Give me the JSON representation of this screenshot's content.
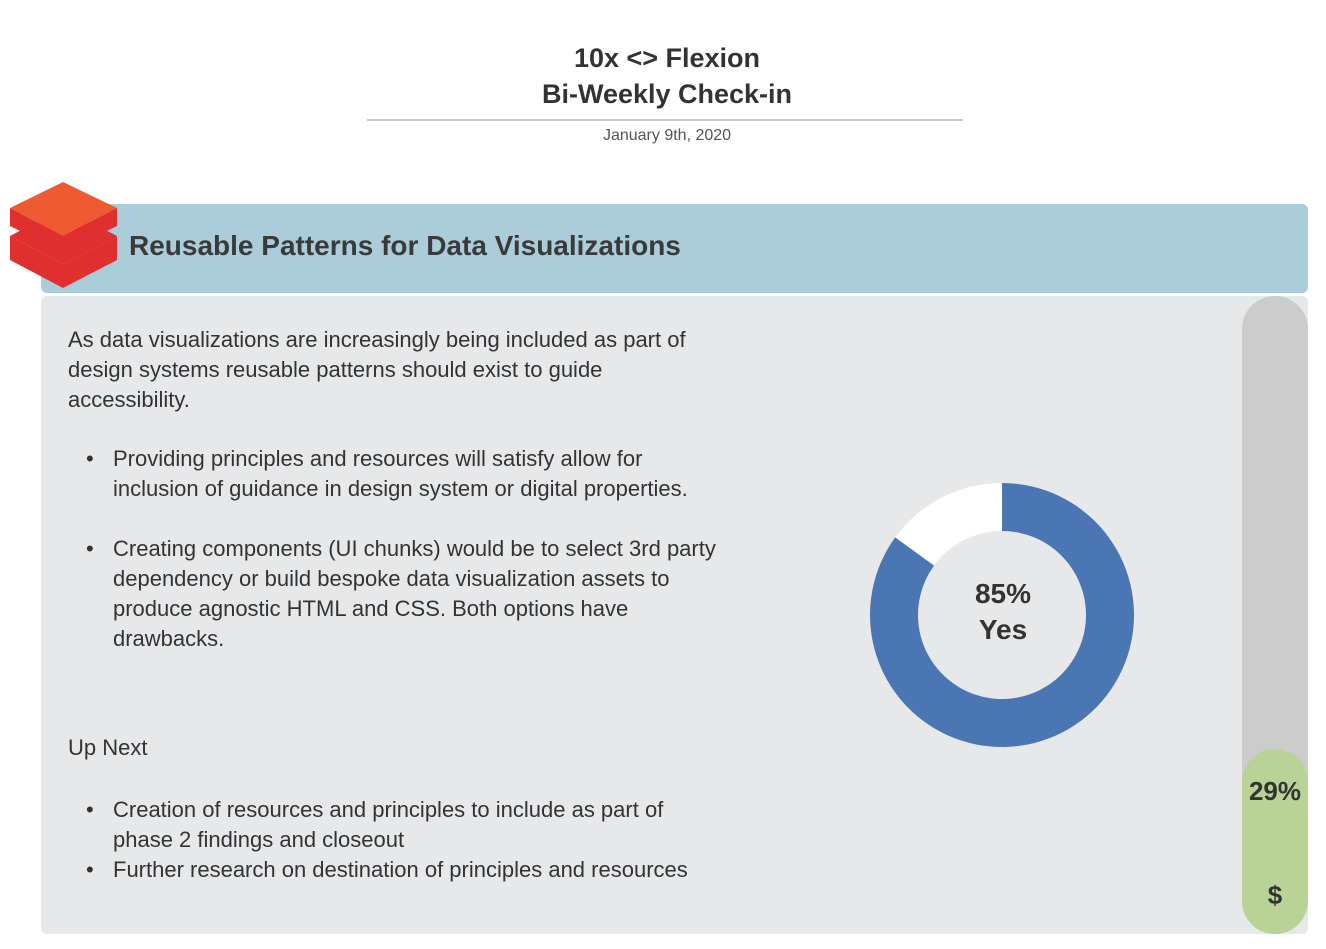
{
  "header": {
    "title_line1": "10x <> Flexion",
    "title_line2": "Bi-Weekly Check-in",
    "date": "January 9th, 2020"
  },
  "banner": {
    "title": "Reusable Patterns for Data Visualizations",
    "logo_icon": "stacked-layers-icon",
    "colors": {
      "banner_bg": "#abcdd9",
      "logo_top": "#f05a33",
      "logo_bottom": "#e02f2f"
    }
  },
  "content": {
    "intro": "As data visualizations are increasingly being included as part of design systems reusable patterns should exist to guide accessibility.",
    "bullets": [
      "Providing principles and resources will satisfy allow for inclusion of guidance in design system or digital properties.",
      "Creating components (UI chunks) would be to select 3rd party dependency or build bespoke data visualization assets to produce agnostic HTML and CSS. Both options have drawbacks."
    ],
    "up_next_heading": "Up Next",
    "up_next_items": [
      "Creation of resources and principles to include as part of phase 2 findings and closeout",
      "Further research on destination of principles and resources"
    ],
    "bullet_glyph": "•"
  },
  "donut": {
    "value_label": "85%",
    "category_label": "Yes",
    "fraction": 0.85,
    "colors": {
      "filled": "#4a76b3",
      "remaining": "#ffffff"
    }
  },
  "budget_bar": {
    "value_label": "29%",
    "unit_label": "$",
    "fraction": 0.29,
    "colors": {
      "track": "#cccccc",
      "fill": "#b9d396"
    }
  }
}
